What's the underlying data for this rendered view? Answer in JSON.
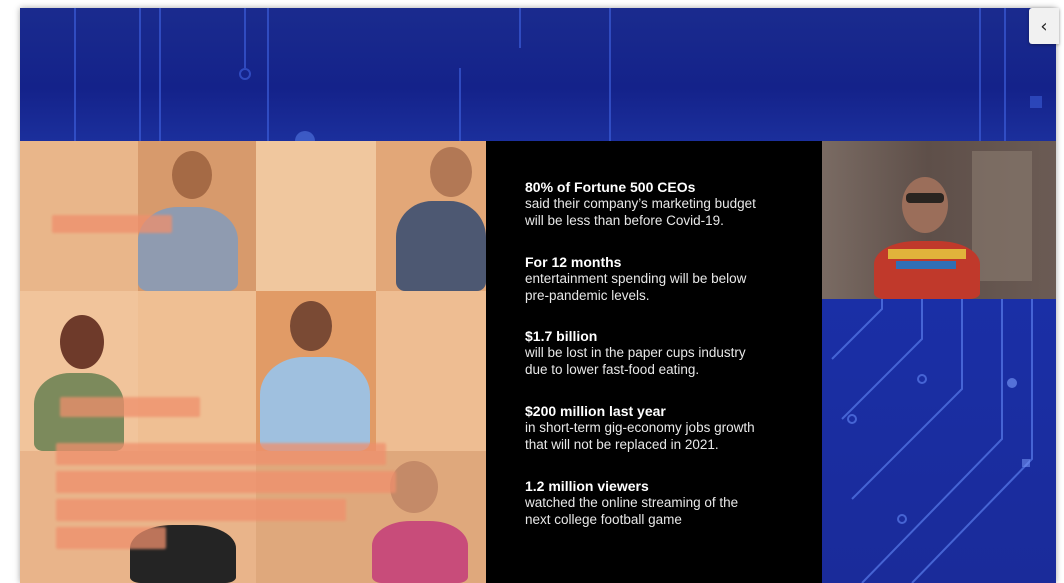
{
  "stats": [
    {
      "title": "80% of  Fortune 500 CEOs",
      "lines": [
        "said their company’s marketing budget",
        "will be less than before Covid-19."
      ]
    },
    {
      "title": "For 12 months",
      "lines": [
        "entertainment spending will be below",
        "pre-pandemic levels."
      ]
    },
    {
      "title": "$1.7 billion",
      "lines": [
        "will be lost in the paper cups industry",
        "due to lower fast-food eating."
      ]
    },
    {
      "title": "$200 million last year",
      "lines": [
        "in short-term gig-economy jobs growth",
        "that will not be replaced in 2021."
      ]
    },
    {
      "title": "1.2 million viewers",
      "lines": [
        "watched the online streaming of the",
        "next college football game"
      ]
    }
  ],
  "collapse_button": {
    "glyph": "‹",
    "icon": "chevron-left-icon"
  },
  "colors": {
    "background_blue": "#16238a",
    "panel_black": "#000000",
    "photo_peach": "#f0b98c"
  }
}
